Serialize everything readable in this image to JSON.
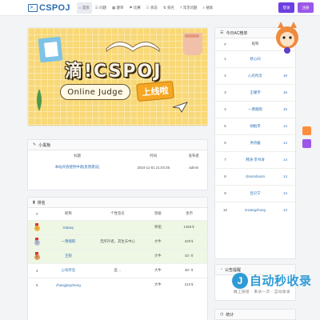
{
  "brand": {
    "logo_glyph": ">_",
    "name": "CSPOJ"
  },
  "nav": {
    "items": [
      {
        "icon": "⌂",
        "label": "首页",
        "active": true
      },
      {
        "icon": "☰",
        "label": "问题",
        "active": false
      },
      {
        "icon": "▦",
        "label": "题单",
        "active": false
      },
      {
        "icon": "⚑",
        "label": "比赛",
        "active": false
      },
      {
        "icon": "☷",
        "label": "状态",
        "active": false
      },
      {
        "icon": "⇅",
        "label": "排名",
        "active": false
      },
      {
        "icon": "?",
        "label": "常见问题",
        "active": false
      },
      {
        "icon": "⌕",
        "label": "搜索",
        "active": false
      }
    ],
    "login": "登录",
    "register": "注册"
  },
  "banner": {
    "title": "滴!CSPOJ",
    "subtitle": "Online Judge",
    "badge": "上线啦"
  },
  "notice": {
    "heading": "小黑板",
    "columns": [
      "标题",
      "时间",
      "发布者"
    ],
    "rows": [
      {
        "title": "本站开放使用中请(反馈建议)",
        "time": "2024-11-01 21:04:35",
        "author": "admin"
      }
    ]
  },
  "rank": {
    "heading": "排名",
    "columns": [
      "#",
      "昵称",
      "个性签名",
      "等级",
      "金币"
    ],
    "rows": [
      {
        "rank": "1",
        "nick": "Galaxy",
        "sign": "",
        "level": "师祖",
        "coins": "1456￥"
      },
      {
        "rank": "2",
        "nick": "一萧烟雨",
        "sign": "无所存者，其生天中心",
        "level": "大牛",
        "coins": "229￥"
      },
      {
        "rank": "3",
        "nick": "王锐",
        "sign": "",
        "level": "大牛",
        "coins": "43↑￥"
      },
      {
        "rank": "4",
        "nick": "心有所念",
        "sign": "匠…",
        "level": "大牛",
        "coins": "48↑￥"
      },
      {
        "rank": "5",
        "nick": "zhangjingcheng",
        "sign": "",
        "level": "大牛",
        "coins": "213￥"
      }
    ]
  },
  "ac_rank": {
    "heading": "今日AC榜单",
    "columns": [
      "#",
      "昵称",
      "AC"
    ],
    "rows": [
      {
        "rank": "1",
        "nick": "修心间",
        "ac": ""
      },
      {
        "rank": "2",
        "nick": "心有所念",
        "ac": "19"
      },
      {
        "rank": "3",
        "nick": "王耀宇",
        "ac": "16"
      },
      {
        "rank": "4",
        "nick": "一萧烟雨",
        "ac": "15"
      },
      {
        "rank": "5",
        "nick": "胡柏李",
        "ac": "14"
      },
      {
        "rank": "6",
        "nick": "洪诗媛",
        "ac": "14"
      },
      {
        "rank": "7",
        "nick": "韩涛-李书涛",
        "ac": "14"
      },
      {
        "rank": "8",
        "nick": "cboomboom",
        "ac": "14"
      },
      {
        "rank": "9",
        "nick": "吕贝宁",
        "ac": "14"
      },
      {
        "rank": "10",
        "nick": "inxiangzhong",
        "ac": "13"
      }
    ]
  },
  "side_cards": {
    "mini1": "公告提醒",
    "mini2": "统计"
  },
  "watermark": {
    "logo": "J",
    "text": "自动秒收录",
    "sub": "做上链接 · 来访一次 · 自动收录"
  },
  "colors": {
    "primary": "#2f6fb6",
    "login": "#6d3fe0",
    "register": "#9b57e8",
    "banner": "#f8d877",
    "badge": "#f5a623"
  }
}
